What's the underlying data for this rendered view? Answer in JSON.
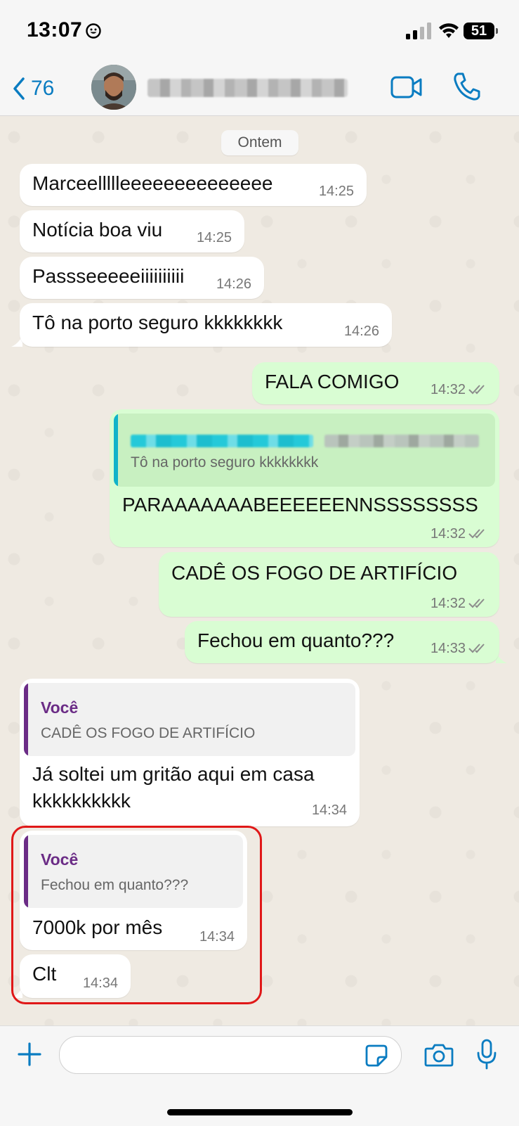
{
  "status_bar": {
    "time": "13:07",
    "battery": "51"
  },
  "header": {
    "back_count": "76"
  },
  "chat": {
    "date_separator": "Ontem",
    "messages": [
      {
        "dir": "in",
        "text": "Marceellllleeeeeeeeeeeeee",
        "time": "14:25"
      },
      {
        "dir": "in",
        "text": "Notícia boa viu",
        "time": "14:25"
      },
      {
        "dir": "in",
        "text": "Passseeeeeiiiiiiiiii",
        "time": "14:26"
      },
      {
        "dir": "in",
        "text": "Tô na porto seguro kkkkkkkk",
        "time": "14:26"
      },
      {
        "dir": "out",
        "text": "FALA COMIGO",
        "time": "14:32"
      },
      {
        "dir": "out",
        "quote_text": "Tô na porto seguro kkkkkkkk",
        "text": "PARAAAAAAABEEEEEENNSSSSSSSS",
        "time": "14:32"
      },
      {
        "dir": "out",
        "text": "CADÊ OS FOGO DE ARTIFÍCIO",
        "time": "14:32"
      },
      {
        "dir": "out",
        "text": "Fechou em quanto???",
        "time": "14:33"
      },
      {
        "dir": "in",
        "quote_author": "Você",
        "quote_text": "CADÊ OS FOGO DE ARTIFÍCIO",
        "text_line1": "Já soltei um gritão aqui em casa",
        "text_line2": "kkkkkkkkkk",
        "time": "14:34"
      },
      {
        "dir": "in",
        "quote_author": "Você",
        "quote_text": "Fechou em quanto???",
        "text": "7000k por mês",
        "time": "14:34"
      },
      {
        "dir": "in",
        "text": "Clt",
        "time": "14:34"
      }
    ]
  },
  "colors": {
    "accent": "#0a7cc1",
    "incoming": "#ffffff",
    "outgoing": "#d9fdd3",
    "quote_author": "#6b2c86",
    "highlight": "#e01818"
  }
}
